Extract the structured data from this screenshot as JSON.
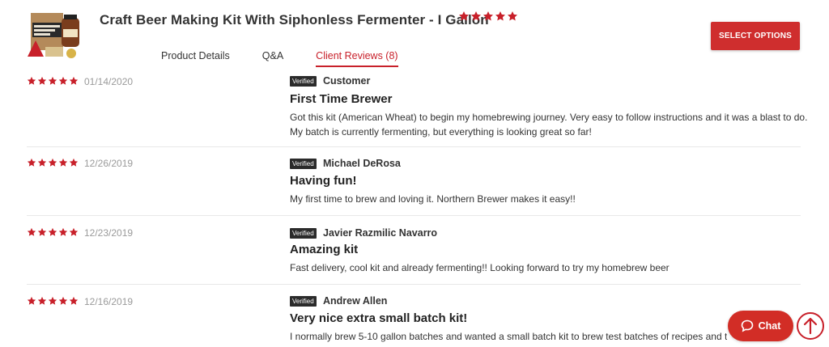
{
  "colors": {
    "accent": "#c8202a",
    "star": "#c8202a",
    "button": "#cf2e2e"
  },
  "product": {
    "title": "Craft Beer Making Kit With Siphonless Fermenter - I Gallon",
    "rating_stars": 5,
    "thumbnail_text": "CRAFT BEER MAKING KIT"
  },
  "tabs": [
    {
      "label": "Product Details",
      "active": false
    },
    {
      "label": "Q&A",
      "active": false
    },
    {
      "label": "Client Reviews (8)",
      "active": true
    }
  ],
  "select_options_label": "SELECT OPTIONS",
  "verified_label": "Verified",
  "reviews": [
    {
      "stars": 5,
      "date": "01/14/2020",
      "author": "Customer",
      "title": "First Time Brewer",
      "body": "Got this kit (American Wheat) to begin my homebrewing journey. Very easy to follow instructions and it was a blast to do. My batch is currently fermenting, but everything is looking great so far!"
    },
    {
      "stars": 5,
      "date": "12/26/2019",
      "author": "Michael DeRosa",
      "title": "Having fun!",
      "body": "My first time to brew and loving it. Northern Brewer makes it easy!!"
    },
    {
      "stars": 5,
      "date": "12/23/2019",
      "author": "Javier Razmilic Navarro",
      "title": "Amazing kit",
      "body": "Fast delivery, cool kit and already fermenting!! Looking forward to try my homebrew beer"
    },
    {
      "stars": 5,
      "date": "12/16/2019",
      "author": "Andrew Allen",
      "title": "Very nice extra small batch kit!",
      "body": "I normally brew 5-10 gallon batches and wanted a small batch kit to brew test batches of recipes and the kit"
    }
  ],
  "chat": {
    "label": "Chat",
    "icon": "chat-bubble-icon"
  },
  "scroll_top": {
    "icon": "arrow-up-icon"
  }
}
